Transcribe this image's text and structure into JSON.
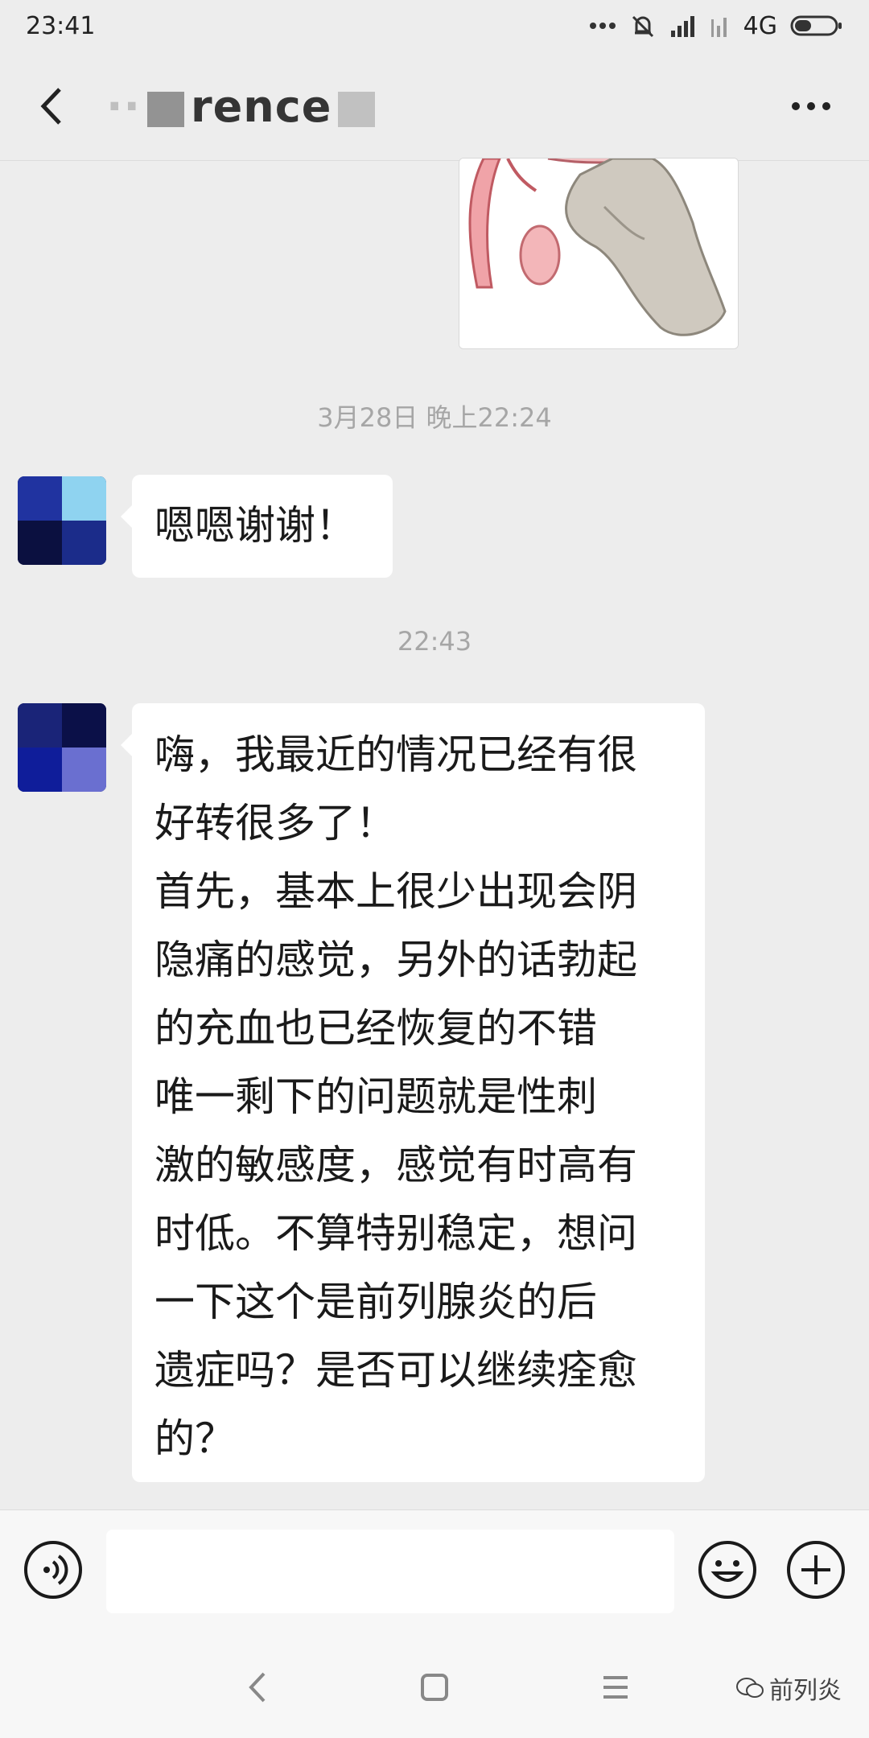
{
  "status_bar": {
    "time": "23:41",
    "network": "4G"
  },
  "header": {
    "title_visible": "rence",
    "more_icon": "more-dots-icon",
    "back_icon": "back-chevron-icon"
  },
  "messages": {
    "image_message": {
      "description_icon": "medical-illustration-image"
    },
    "timestamp_1": "3月28日 晚上22:24",
    "bubble_1": {
      "text": "嗯嗯谢谢！"
    },
    "timestamp_2": "22:43",
    "bubble_2": {
      "lines": [
        "嗨，我最近的情况已经有很",
        "好转很多了！",
        "首先，基本上很少出现会阴",
        "隐痛的感觉，另外的话勃起",
        "的充血也已经恢复的不错",
        "唯一剩下的问题就是性刺",
        "激的敏感度，感觉有时高有",
        "时低。不算特别稳定，想问",
        "一下这个是前列腺炎的后",
        "遗症吗？是否可以继续痊愈",
        "的？"
      ]
    }
  },
  "input_bar": {
    "voice_icon": "voice-icon",
    "emoji_icon": "emoji-icon",
    "plus_icon": "plus-icon",
    "input_value": ""
  },
  "system_nav": {
    "back_icon": "nav-back-icon",
    "home_icon": "nav-home-icon",
    "menu_icon": "nav-menu-icon"
  },
  "watermark": {
    "text": "前列炎"
  }
}
